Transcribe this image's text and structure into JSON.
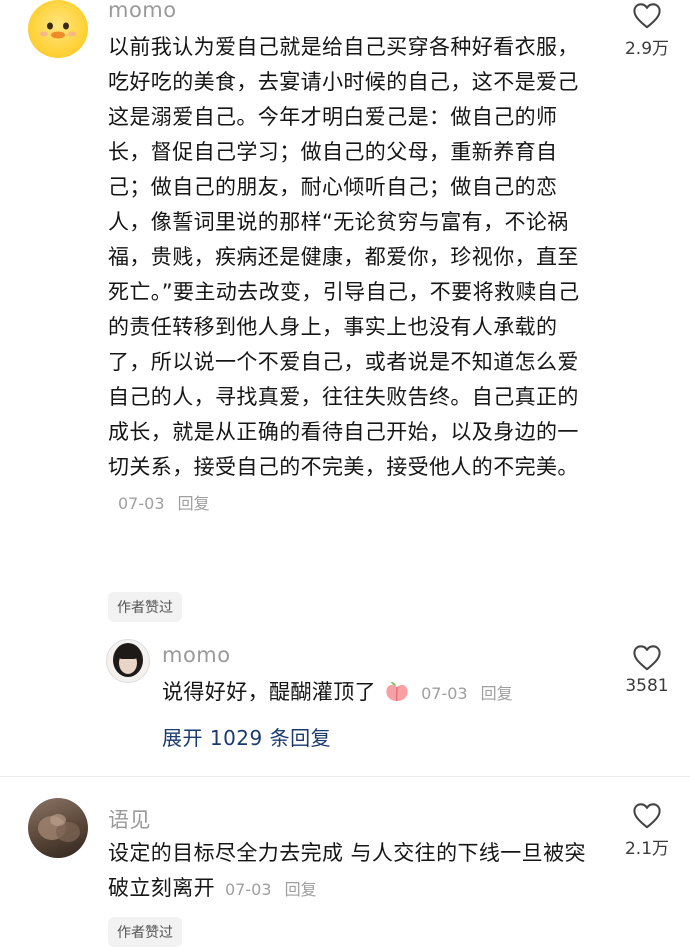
{
  "comments": [
    {
      "username": "momo",
      "text": "以前我认为爱自己就是给自己买穿各种好看衣服，吃好吃的美食，去宴请小时候的自己，这不是爱己这是溺爱自己。今年才明白爱己是：做自己的师长，督促自己学习；做自己的父母，重新养育自己；做自己的朋友，耐心倾听自己；做自己的恋人，像誓词里说的那样“无论贫穷与富有，不论祸福，贵贱，疾病还是健康，都爱你，珍视你，直至死亡。”要主动去改变，引导自己，不要将救赎自己的责任转移到他人身上，事实上也没有人承载的了，所以说一个不爱自己，或者说是不知道怎么爱自己的人，寻找真爱，往往失败告终。自己真正的成长，就是从正确的看待自己开始，以及身边的一切关系，接受自己的不完美，接受他人的不完美。",
      "date": "07-03",
      "reply_label": "回复",
      "likes": "2.9万",
      "author_liked": "作者赞过",
      "reply": {
        "username": "momo",
        "text": "说得好好，醍醐灌顶了",
        "date": "07-03",
        "reply_label": "回复",
        "likes": "3581"
      },
      "expand_label": "展开 1029 条回复"
    },
    {
      "username": "语见",
      "text": "设定的目标尽全力去完成 与人交往的下线一旦被突破立刻离开",
      "date": "07-03",
      "reply_label": "回复",
      "likes": "2.1万",
      "author_liked": "作者赞过"
    }
  ]
}
